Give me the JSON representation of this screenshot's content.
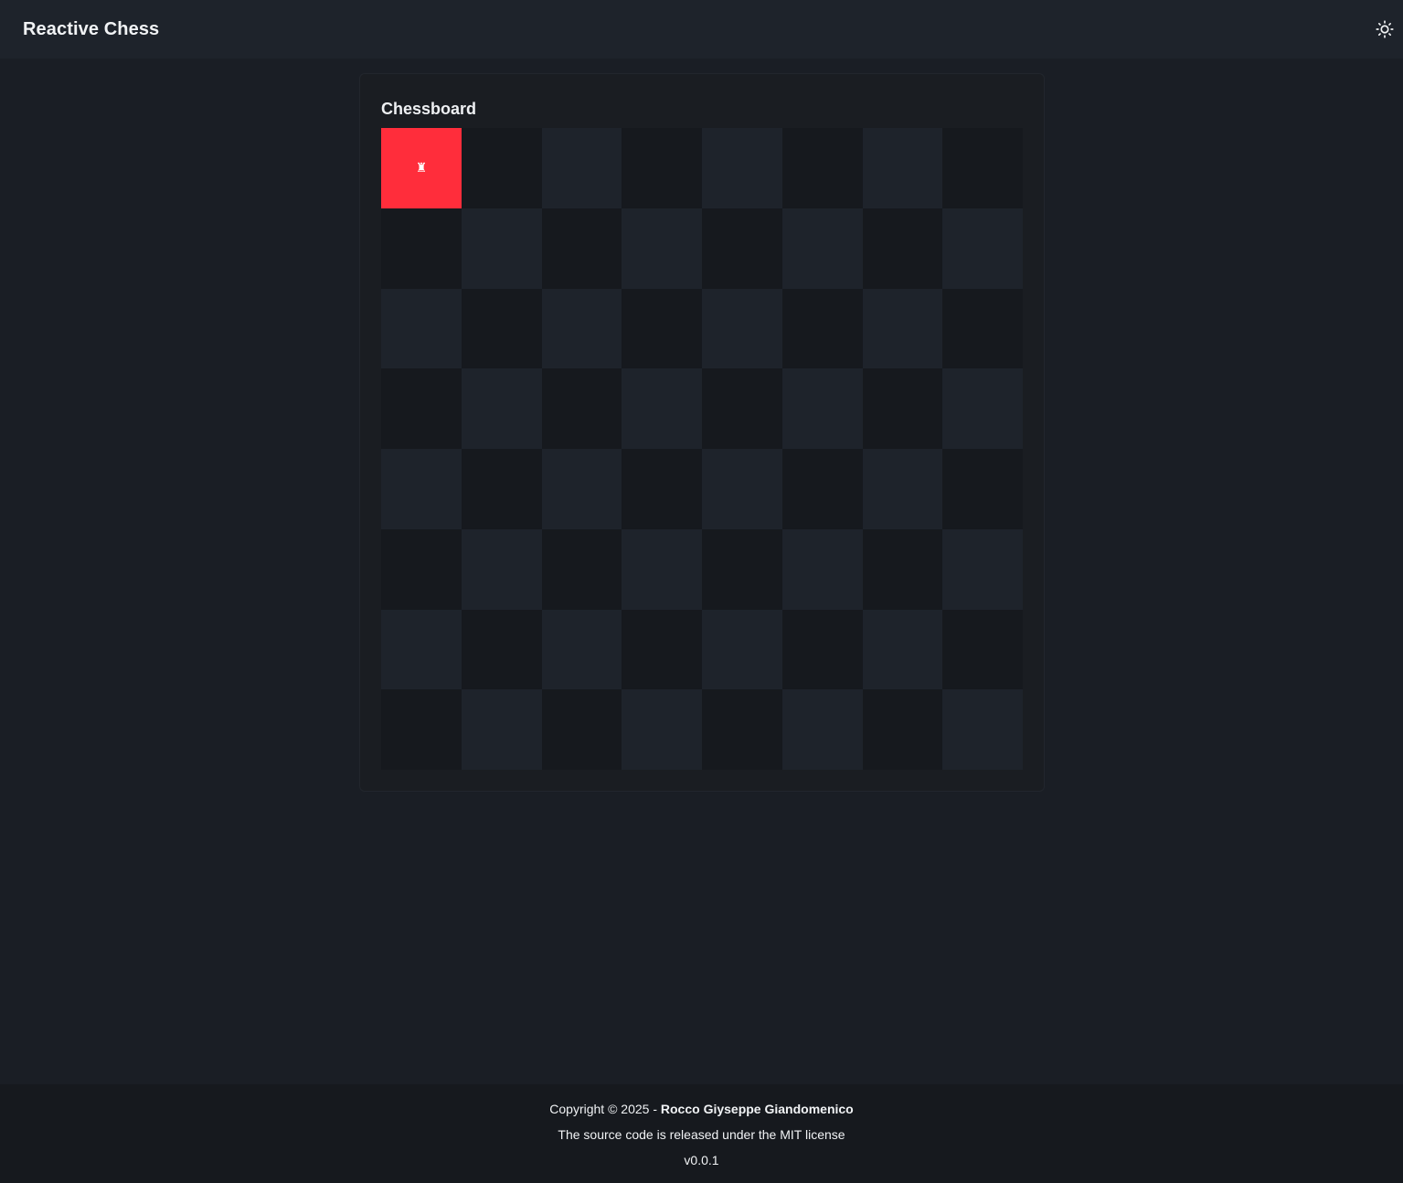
{
  "header": {
    "title": "Reactive Chess",
    "theme_icon": "sun-icon"
  },
  "card": {
    "title": "Chessboard"
  },
  "board": {
    "rows": 8,
    "cols": 8,
    "selected_square": "a8",
    "pieces": [
      {
        "square": "a8",
        "glyph": "♜",
        "name": "rook"
      }
    ],
    "colors": {
      "light": "#1e232b",
      "dark": "#16191e",
      "selected": "#ff2d3b"
    }
  },
  "footer": {
    "copyright_prefix": "Copyright © 2025 - ",
    "author": "Rocco Giyseppe Giandomenico",
    "license": "The source code is released under the MIT license",
    "version": "v0.0.1"
  }
}
